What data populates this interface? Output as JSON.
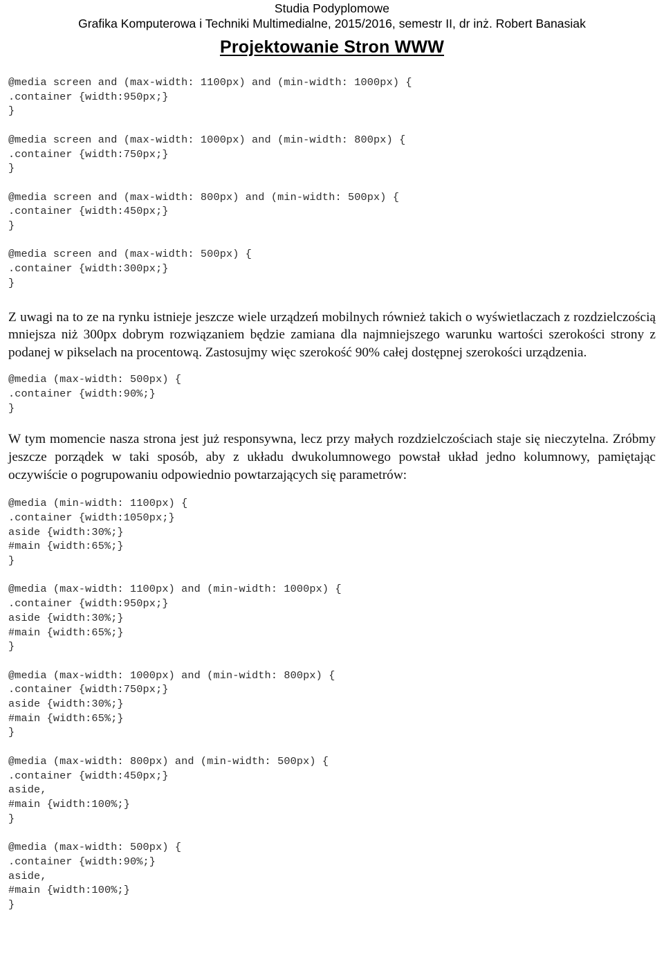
{
  "header": {
    "line1": "Studia Podyplomowe",
    "line2": "Grafika Komputerowa i Techniki Multimedialne, 2015/2016, semestr II, dr inż. Robert Banasiak",
    "title": "Projektowanie Stron WWW"
  },
  "code_block_1": "@media screen and (max-width: 1100px) and (min-width: 1000px) {\n.container {width:950px;}\n}\n\n@media screen and (max-width: 1000px) and (min-width: 800px) {\n.container {width:750px;}\n}\n\n@media screen and (max-width: 800px) and (min-width: 500px) {\n.container {width:450px;}\n}\n\n@media screen and (max-width: 500px) {\n.container {width:300px;}\n}",
  "paragraph_1": "Z uwagi na to ze na rynku istnieje jeszcze wiele urządzeń mobilnych również takich o wyświetlaczach z rozdzielczością mniejsza niż 300px dobrym rozwiązaniem będzie zamiana dla najmniejszego warunku wartości szerokości strony z podanej w pikselach na procentową. Zastosujmy więc szerokość 90% całej dostępnej szerokości urządzenia.",
  "code_block_2": "@media (max-width: 500px) {\n.container {width:90%;}\n}",
  "paragraph_2": "W tym momencie nasza strona jest już responsywna, lecz przy małych rozdzielczościach staje się nieczytelna. Zróbmy jeszcze porządek w taki sposób, aby z układu dwukolumnowego powstał układ jedno kolumnowy, pamiętając oczywiście o pogrupowaniu odpowiednio powtarzających się parametrów:",
  "code_block_3": "@media (min-width: 1100px) {\n.container {width:1050px;}\naside {width:30%;}\n#main {width:65%;}\n}\n\n@media (max-width: 1100px) and (min-width: 1000px) {\n.container {width:950px;}\naside {width:30%;}\n#main {width:65%;}\n}\n\n@media (max-width: 1000px) and (min-width: 800px) {\n.container {width:750px;}\naside {width:30%;}\n#main {width:65%;}\n}\n\n@media (max-width: 800px) and (min-width: 500px) {\n.container {width:450px;}\naside,\n#main {width:100%;}\n}\n\n@media (max-width: 500px) {\n.container {width:90%;}\naside,\n#main {width:100%;}\n}"
}
